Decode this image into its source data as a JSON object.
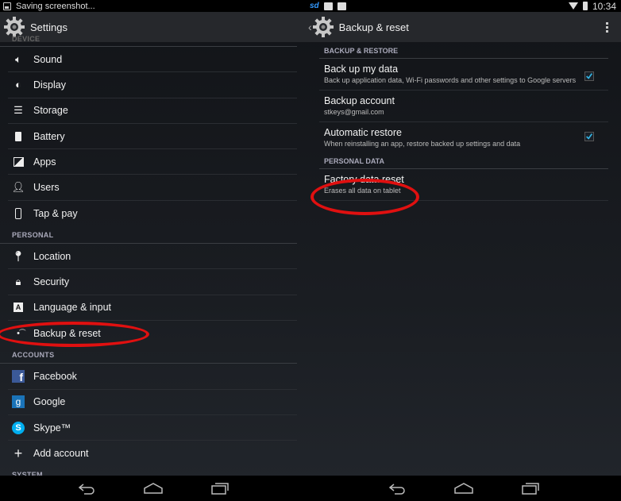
{
  "left": {
    "status": {
      "text": "Saving screenshot..."
    },
    "actionbar": {
      "title": "Settings"
    },
    "sections": [
      {
        "header": "DEVICE",
        "items": [
          {
            "label": "Sound",
            "icon": "sound-icon"
          },
          {
            "label": "Display",
            "icon": "display-icon"
          },
          {
            "label": "Storage",
            "icon": "storage-icon"
          },
          {
            "label": "Battery",
            "icon": "battery-icon"
          },
          {
            "label": "Apps",
            "icon": "apps-icon"
          },
          {
            "label": "Users",
            "icon": "users-icon"
          },
          {
            "label": "Tap & pay",
            "icon": "tap-pay-icon"
          }
        ]
      },
      {
        "header": "PERSONAL",
        "items": [
          {
            "label": "Location",
            "icon": "location-icon"
          },
          {
            "label": "Security",
            "icon": "lock-icon"
          },
          {
            "label": "Language & input",
            "icon": "language-icon"
          },
          {
            "label": "Backup & reset",
            "icon": "backup-icon"
          }
        ]
      },
      {
        "header": "ACCOUNTS",
        "items": [
          {
            "label": "Facebook",
            "icon": "facebook-icon"
          },
          {
            "label": "Google",
            "icon": "google-icon"
          },
          {
            "label": "Skype™",
            "icon": "skype-icon"
          },
          {
            "label": "Add account",
            "icon": "plus-icon"
          }
        ]
      },
      {
        "header": "SYSTEM",
        "items": []
      }
    ]
  },
  "right": {
    "status": {
      "time": "10:34"
    },
    "actionbar": {
      "title": "Backup & reset"
    },
    "sections": [
      {
        "header": "BACKUP & RESTORE",
        "items": [
          {
            "title": "Back up my data",
            "summary": "Back up application data, Wi-Fi passwords and other settings to Google servers",
            "checked": true
          },
          {
            "title": "Backup account",
            "summary": "stkeys@gmail.com",
            "checked": null
          },
          {
            "title": "Automatic restore",
            "summary": "When reinstalling an app, restore backed up settings and data",
            "checked": true
          }
        ]
      },
      {
        "header": "PERSONAL DATA",
        "items": [
          {
            "title": "Factory data reset",
            "summary": "Erases all data on tablet",
            "checked": null
          }
        ]
      }
    ]
  },
  "colors": {
    "accent": "#33b5e5",
    "highlight": "#e01010",
    "actionbar": "#26282c"
  }
}
